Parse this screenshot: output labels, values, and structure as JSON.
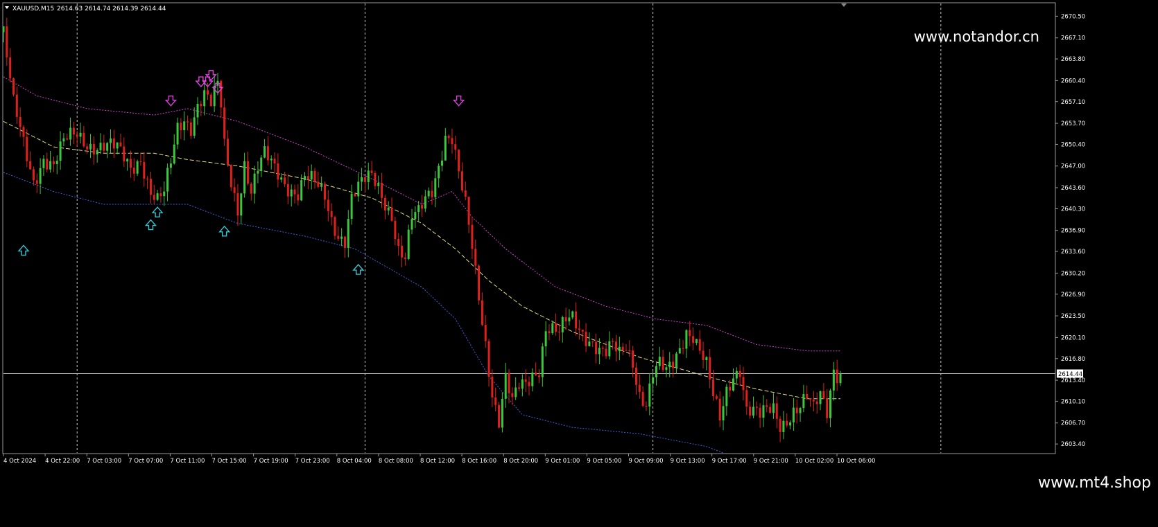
{
  "header": {
    "symbol_text": "XAUUSD,M15",
    "ohlc_text": "2614.63 2614.74 2614.39 2614.44"
  },
  "watermarks": {
    "top": "www.notandor.cn",
    "bottom": "www.mt4.shop"
  },
  "colors": {
    "background": "#000000",
    "up_candle": "#3cc83c",
    "down_candle": "#e0201c",
    "grid": "#c8c8c8",
    "upper_band": "#d040d0",
    "lower_band": "#4060e0",
    "middle_line": "#e8e080",
    "sell_arrow": "#e040e0",
    "buy_arrow": "#30c8d8",
    "price_line": "#c0c0c0"
  },
  "chart_data": {
    "type": "candlestick",
    "symbol": "XAUUSD",
    "timeframe": "M15",
    "current_price": 2614.44,
    "ylim": [
      2602.0,
      2672.5
    ],
    "y_ticks": [
      "2670.50",
      "2667.10",
      "2663.80",
      "2660.40",
      "2657.10",
      "2653.70",
      "2650.40",
      "2647.00",
      "2643.60",
      "2640.30",
      "2636.90",
      "2633.60",
      "2630.20",
      "2626.90",
      "2623.50",
      "2620.10",
      "2616.80",
      "2613.40",
      "2610.10",
      "2606.70",
      "2603.40"
    ],
    "x_ticks": [
      "4 Oct 2024",
      "4 Oct 22:00",
      "7 Oct 03:00",
      "7 Oct 07:00",
      "7 Oct 11:00",
      "7 Oct 15:00",
      "7 Oct 19:00",
      "7 Oct 23:00",
      "8 Oct 04:00",
      "8 Oct 08:00",
      "8 Oct 12:00",
      "8 Oct 16:00",
      "8 Oct 20:00",
      "9 Oct 01:00",
      "9 Oct 05:00",
      "9 Oct 09:00",
      "9 Oct 13:00",
      "9 Oct 17:00",
      "9 Oct 21:00",
      "10 Oct 02:00",
      "10 Oct 06:00"
    ],
    "price_path": [
      [
        0,
        2668
      ],
      [
        3,
        2656
      ],
      [
        6,
        2650
      ],
      [
        9,
        2645
      ],
      [
        12,
        2649
      ],
      [
        15,
        2647
      ],
      [
        18,
        2650
      ],
      [
        22,
        2652
      ],
      [
        26,
        2651
      ],
      [
        30,
        2650
      ],
      [
        34,
        2649
      ],
      [
        38,
        2647
      ],
      [
        41,
        2649
      ],
      [
        44,
        2643
      ],
      [
        46,
        2641
      ],
      [
        48,
        2642
      ],
      [
        50,
        2647
      ],
      [
        52,
        2653
      ],
      [
        54,
        2655
      ],
      [
        56,
        2654
      ],
      [
        58,
        2657
      ],
      [
        60,
        2658
      ],
      [
        62,
        2656
      ],
      [
        64,
        2659
      ],
      [
        65,
        2656
      ],
      [
        66,
        2650
      ],
      [
        68,
        2645
      ],
      [
        70,
        2641
      ],
      [
        72,
        2648
      ],
      [
        74,
        2643
      ],
      [
        76,
        2646
      ],
      [
        78,
        2648
      ],
      [
        80,
        2647
      ],
      [
        82,
        2646
      ],
      [
        84,
        2645
      ],
      [
        86,
        2644
      ],
      [
        88,
        2643
      ],
      [
        90,
        2645
      ],
      [
        92,
        2644
      ],
      [
        94,
        2643
      ],
      [
        96,
        2642
      ],
      [
        98,
        2639
      ],
      [
        100,
        2637
      ],
      [
        102,
        2636
      ],
      [
        104,
        2642
      ],
      [
        106,
        2643
      ],
      [
        108,
        2644
      ],
      [
        110,
        2645
      ],
      [
        112,
        2644
      ],
      [
        114,
        2642
      ],
      [
        116,
        2640
      ],
      [
        118,
        2634
      ],
      [
        120,
        2632
      ],
      [
        122,
        2638
      ],
      [
        124,
        2639
      ],
      [
        126,
        2642
      ],
      [
        128,
        2644
      ],
      [
        130,
        2648
      ],
      [
        132,
        2652
      ],
      [
        134,
        2651
      ],
      [
        136,
        2645
      ],
      [
        138,
        2640
      ],
      [
        140,
        2634
      ],
      [
        142,
        2627
      ],
      [
        144,
        2620
      ],
      [
        146,
        2612
      ],
      [
        148,
        2607
      ],
      [
        150,
        2613
      ],
      [
        152,
        2609
      ],
      [
        154,
        2612
      ],
      [
        156,
        2613
      ],
      [
        158,
        2615
      ],
      [
        160,
        2616
      ],
      [
        162,
        2622
      ],
      [
        164,
        2621
      ],
      [
        166,
        2620
      ],
      [
        168,
        2622
      ],
      [
        170,
        2623
      ],
      [
        172,
        2622
      ],
      [
        174,
        2621
      ],
      [
        176,
        2620
      ],
      [
        178,
        2618
      ],
      [
        180,
        2617
      ],
      [
        182,
        2618
      ],
      [
        184,
        2617
      ],
      [
        186,
        2619
      ],
      [
        188,
        2617
      ],
      [
        190,
        2612
      ],
      [
        192,
        2610
      ],
      [
        194,
        2614
      ],
      [
        196,
        2615
      ],
      [
        198,
        2614
      ],
      [
        200,
        2616
      ],
      [
        202,
        2619
      ],
      [
        204,
        2622
      ],
      [
        206,
        2621
      ],
      [
        208,
        2618
      ],
      [
        210,
        2615
      ],
      [
        212,
        2610
      ],
      [
        214,
        2607
      ],
      [
        216,
        2612
      ],
      [
        218,
        2615
      ],
      [
        220,
        2616
      ],
      [
        222,
        2609
      ],
      [
        224,
        2608
      ],
      [
        226,
        2607
      ],
      [
        228,
        2608
      ],
      [
        230,
        2609
      ],
      [
        232,
        2607
      ],
      [
        234,
        2608
      ],
      [
        236,
        2609
      ],
      [
        238,
        2609
      ],
      [
        240,
        2610
      ],
      [
        242,
        2608
      ],
      [
        244,
        2611
      ],
      [
        246,
        2609
      ],
      [
        248,
        2616
      ],
      [
        250,
        2614.44
      ]
    ],
    "upper_band": [
      [
        0,
        2661
      ],
      [
        10,
        2658
      ],
      [
        25,
        2656
      ],
      [
        45,
        2655
      ],
      [
        55,
        2656
      ],
      [
        70,
        2654
      ],
      [
        90,
        2650
      ],
      [
        110,
        2645
      ],
      [
        125,
        2641
      ],
      [
        134,
        2643
      ],
      [
        140,
        2639
      ],
      [
        150,
        2634
      ],
      [
        165,
        2628
      ],
      [
        180,
        2625
      ],
      [
        195,
        2623
      ],
      [
        210,
        2622
      ],
      [
        225,
        2619
      ],
      [
        240,
        2618
      ],
      [
        250,
        2618
      ]
    ],
    "middle_line": [
      [
        0,
        2654
      ],
      [
        15,
        2650
      ],
      [
        30,
        2649
      ],
      [
        45,
        2649
      ],
      [
        55,
        2648
      ],
      [
        70,
        2647
      ],
      [
        90,
        2645
      ],
      [
        110,
        2642
      ],
      [
        125,
        2638
      ],
      [
        135,
        2634
      ],
      [
        145,
        2629
      ],
      [
        155,
        2625
      ],
      [
        170,
        2621
      ],
      [
        190,
        2617
      ],
      [
        210,
        2614
      ],
      [
        225,
        2612
      ],
      [
        240,
        2610.5
      ],
      [
        250,
        2610.5
      ]
    ],
    "lower_band": [
      [
        0,
        2646
      ],
      [
        15,
        2643
      ],
      [
        30,
        2641
      ],
      [
        45,
        2641
      ],
      [
        55,
        2641
      ],
      [
        70,
        2638
      ],
      [
        90,
        2636
      ],
      [
        105,
        2634
      ],
      [
        115,
        2631
      ],
      [
        125,
        2628
      ],
      [
        135,
        2623
      ],
      [
        145,
        2614
      ],
      [
        155,
        2608
      ],
      [
        170,
        2606
      ],
      [
        190,
        2605
      ],
      [
        210,
        2603
      ],
      [
        215,
        2602
      ]
    ],
    "sell_signals": [
      [
        50,
        2657
      ],
      [
        59,
        2660
      ],
      [
        61,
        2660
      ],
      [
        62,
        2661
      ],
      [
        64,
        2659
      ],
      [
        136,
        2657
      ]
    ],
    "buy_signals": [
      [
        6,
        2634
      ],
      [
        44,
        2638
      ],
      [
        46,
        2640
      ],
      [
        66,
        2637
      ],
      [
        106,
        2631
      ]
    ]
  }
}
